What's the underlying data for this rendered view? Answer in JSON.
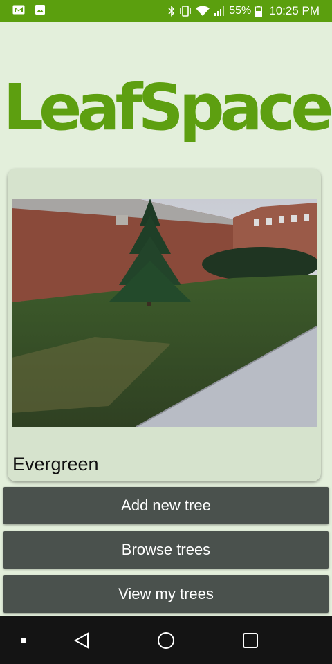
{
  "status_bar": {
    "battery": "55%",
    "time": "10:25 PM",
    "icons": [
      "gmail-icon",
      "gallery-icon",
      "bluetooth-icon",
      "vibrate-icon",
      "wifi-icon",
      "signal-icon",
      "battery-icon"
    ]
  },
  "app": {
    "logo_text": "LeafSpace",
    "accent_color": "#5d9f10"
  },
  "featured_card": {
    "tree_name": "Evergreen"
  },
  "buttons": {
    "add_new": "Add new tree",
    "browse": "Browse trees",
    "view_mine": "View my trees"
  },
  "nav_bar": {
    "icons": [
      "recent-apps-dot-icon",
      "back-icon",
      "home-icon",
      "overview-icon"
    ]
  }
}
